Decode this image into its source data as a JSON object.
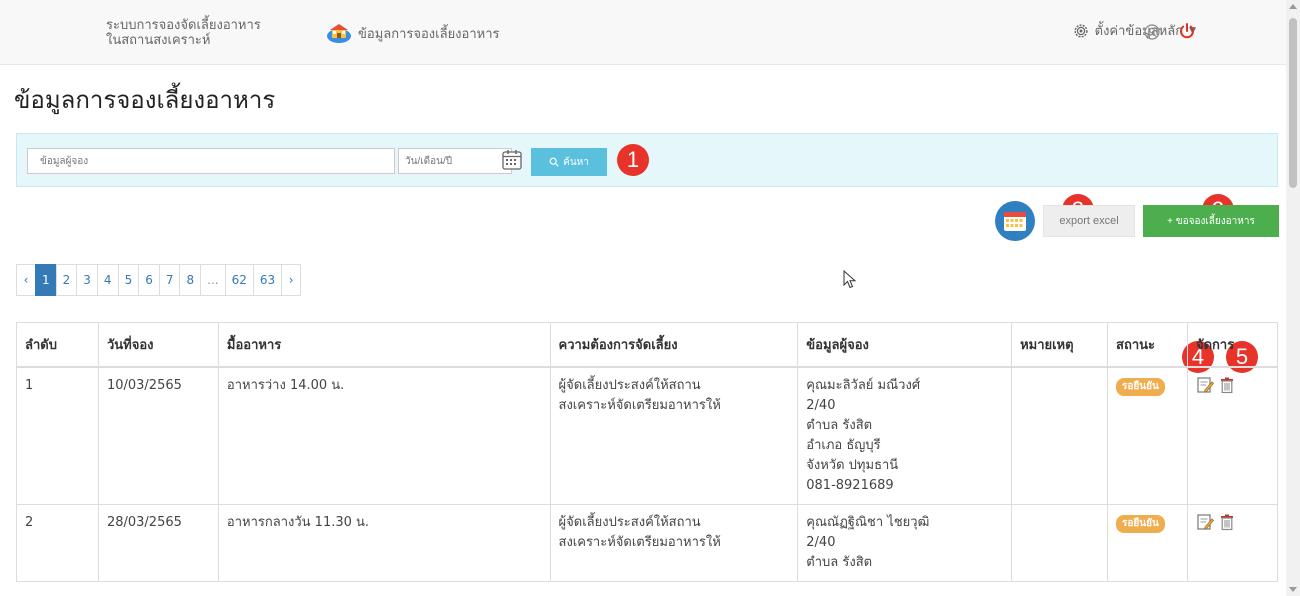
{
  "nav": {
    "brand_line1": "ระบบการจองจัดเลี้ยงอาหาร",
    "brand_line2": "ในสถานสงเคราะห์",
    "link": "ข้อมูลการจองเลี้ยงอาหาร",
    "settings": "ตั้งค่าข้อมูลหลัก"
  },
  "page_title": "ข้อมูลการจองเลี้ยงอาหาร",
  "search": {
    "name_placeholder": "ข้อมูลผู้จอง",
    "date_placeholder": "วัน/เดือน/ปี",
    "button": "ค้นหา"
  },
  "actions": {
    "export": "export excel",
    "add": "+ ขอจองเลี้ยงอาหาร"
  },
  "callouts": [
    "1",
    "2",
    "3",
    "4",
    "5"
  ],
  "pagination": [
    "‹",
    "1",
    "2",
    "3",
    "4",
    "5",
    "6",
    "7",
    "8",
    "...",
    "62",
    "63",
    "›"
  ],
  "pagination_active": "1",
  "table": {
    "headers": [
      "ลำดับ",
      "วันที่จอง",
      "มื้ออาหาร",
      "ความต้องการจัดเลี้ยง",
      "ข้อมูลผู้จอง",
      "หมายเหตุ",
      "สถานะ",
      "จัดการ"
    ],
    "rows": [
      {
        "no": "1",
        "date": "10/03/2565",
        "meal": "อาหารว่าง 14.00 น.",
        "need_line1": "ผู้จัดเลี้ยงประสงค์ให้สถาน",
        "need_line2": "สงเคราะห์จัดเตรียมอาหารให้",
        "booker": [
          "คุณมะลิวัลย์ มณีวงศ์",
          "2/40",
          "ตำบล รังสิต",
          "อำเภอ ธัญบุรี",
          "จังหวัด ปทุมธานี",
          "081-8921689"
        ],
        "note": "",
        "status": "รอยืนยัน"
      },
      {
        "no": "2",
        "date": "28/03/2565",
        "meal": "อาหารกลางวัน 11.30 น.",
        "need_line1": "ผู้จัดเลี้ยงประสงค์ให้สถาน",
        "need_line2": "สงเคราะห์จัดเตรียมอาหารให้",
        "booker": [
          "คุณณัฏฐิณิชา ไชยวุฒิ",
          "2/40",
          "ตำบล รังสิต"
        ],
        "note": "",
        "status": "รอยืนยัน"
      }
    ]
  },
  "colors": {
    "search_btn": "#5bc0de",
    "add_btn": "#4cae4c",
    "status": "#f0ad4e",
    "callout": "#e8332a",
    "pagination_active": "#337ab7"
  }
}
